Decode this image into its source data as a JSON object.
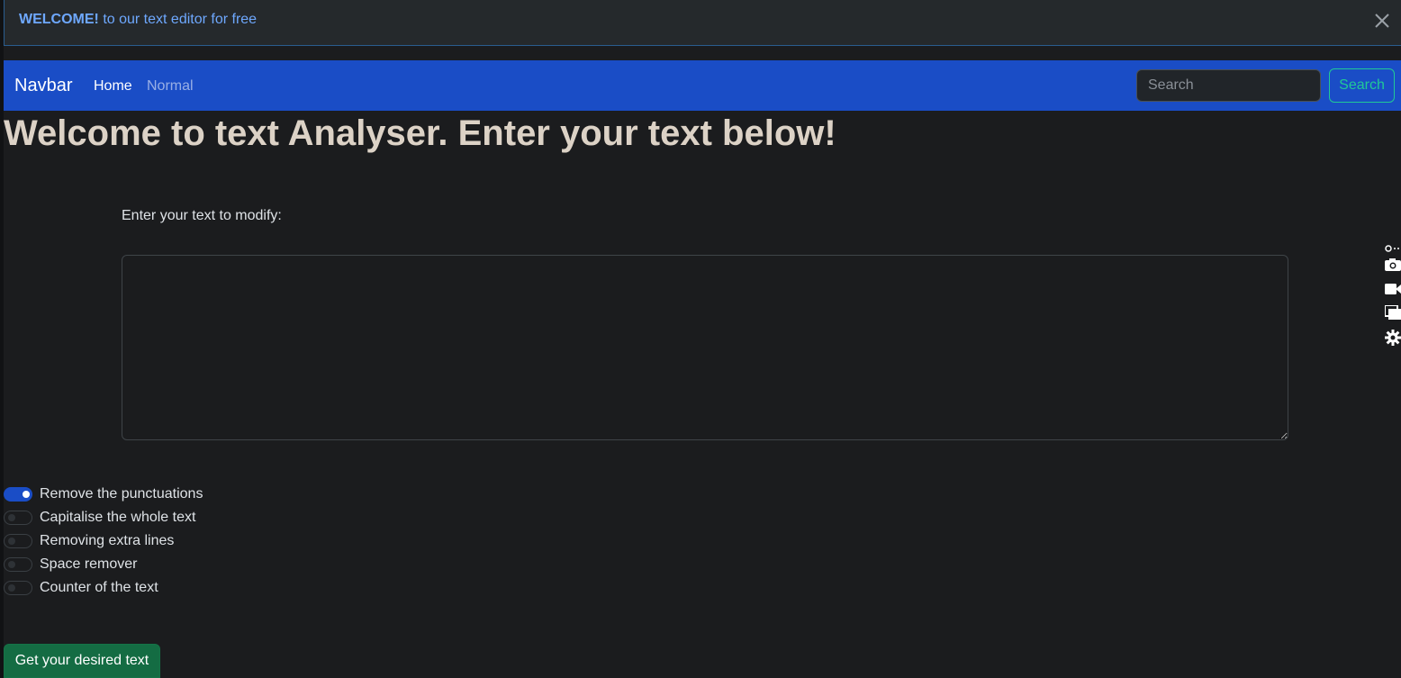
{
  "alert": {
    "strong": "WELCOME!",
    "text": " to our text editor for free",
    "close_icon": "close-icon"
  },
  "navbar": {
    "brand": "Navbar",
    "links": [
      "Home",
      "Normal"
    ],
    "search_placeholder": "Search",
    "search_button": "Search"
  },
  "main": {
    "heading": "Welcome to text Analyser. Enter your text below!",
    "textarea_label": "Enter your text to modify:",
    "textarea_value": ""
  },
  "options": [
    {
      "label": "Remove the punctuations",
      "checked": true
    },
    {
      "label": "Capitalise the whole text",
      "checked": false
    },
    {
      "label": "Removing extra lines",
      "checked": false
    },
    {
      "label": "Space remover",
      "checked": false
    },
    {
      "label": "Counter of the text",
      "checked": false
    }
  ],
  "submit_button": "Get your desired text",
  "side_tools": [
    "link-icon",
    "camera-icon",
    "video-icon",
    "window-icon",
    "gear-icon"
  ],
  "colors": {
    "background": "#1b1c1e",
    "navbar": "#1a4dc6",
    "alert_text": "#6ea8fe",
    "heading": "#dcd2c6",
    "search_button": "#20c997",
    "submit_button": "#146c43",
    "switch_on": "#1a4dc6"
  }
}
